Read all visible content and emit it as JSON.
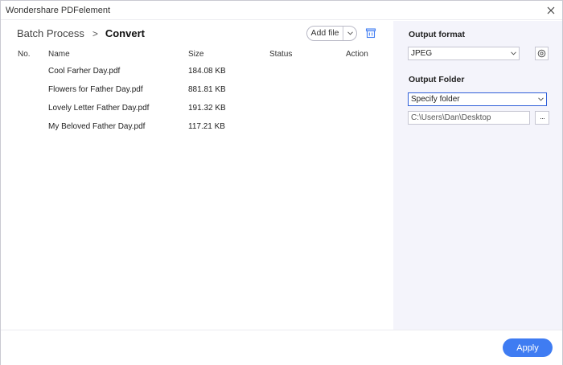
{
  "window": {
    "title": "Wondershare PDFelement"
  },
  "breadcrumb": {
    "parent": "Batch Process",
    "separator": ">",
    "current": "Convert"
  },
  "toolbar": {
    "add_file_label": "Add file",
    "add_file_dropdown_icon": "chevron-down-icon",
    "clear_icon": "trash-icon"
  },
  "table": {
    "columns": [
      "No.",
      "Name",
      "Size",
      "Status",
      "Action"
    ],
    "rows": [
      {
        "no": "",
        "name": "Cool Farher Day.pdf",
        "size": "184.08 KB",
        "status": "",
        "action": ""
      },
      {
        "no": "",
        "name": "Flowers for Father Day.pdf",
        "size": "881.81 KB",
        "status": "",
        "action": ""
      },
      {
        "no": "",
        "name": "Lovely Letter Father Day.pdf",
        "size": "191.32 KB",
        "status": "",
        "action": ""
      },
      {
        "no": "",
        "name": "My Beloved Father Day.pdf",
        "size": "117.21 KB",
        "status": "",
        "action": ""
      }
    ]
  },
  "output_format": {
    "label": "Output format",
    "selected": "JPEG",
    "settings_icon": "settings-icon"
  },
  "output_folder": {
    "label": "Output Folder",
    "selected": "Specify folder",
    "path": "C:\\Users\\Dan\\Desktop",
    "browse_label": "···"
  },
  "footer": {
    "apply_label": "Apply"
  },
  "colors": {
    "accent": "#3f7cf2",
    "sidebar_bg": "#f4f4fb",
    "focus_border": "#2f5fd9"
  }
}
